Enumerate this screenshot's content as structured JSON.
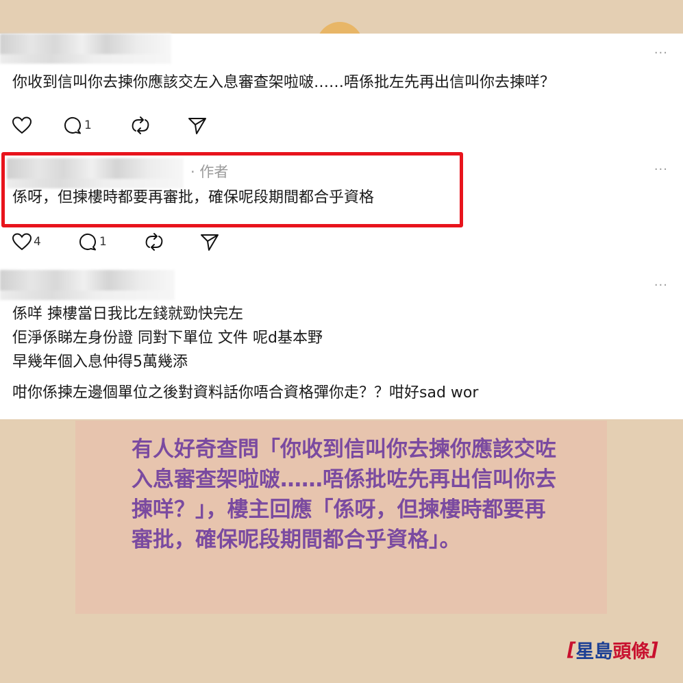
{
  "comments": [
    {
      "text": "你收到信叫你去揀你應該交左入息審查架啦啵……唔係批左先再出信叫你去揀咩？",
      "more": "···",
      "replies": "1",
      "likes": ""
    },
    {
      "author_tag": "· 作者",
      "text": "係呀，但揀樓時都要再審批，確保呢段期間都合乎資格",
      "more": "···",
      "likes": "4",
      "replies": "1"
    },
    {
      "lines": [
        "係咩 揀樓當日我比左錢就勁快完左",
        "佢淨係睇左身份證 同對下單位 文件 呢d基本野",
        "早幾年個入息仲得5萬幾添",
        "咁你係揀左邊個單位之後對資料話你唔合資格彈你走？？咁好sad wor"
      ],
      "more": "···"
    }
  ],
  "caption": "有人好奇查問「你收到信叫你去揀你應該交咗入息審查架啦啵……唔係批咗先再出信叫你去揀咩？」，樓主回應「係呀，但揀樓時都要再審批，確保呢段期間都合乎資格」。",
  "logo": {
    "left_bar": "[",
    "part1": "星島",
    "part2": "頭條",
    "right_bar": "]"
  },
  "icons": [
    "heart-icon",
    "reply-icon",
    "repost-icon",
    "share-icon",
    "more-icon"
  ],
  "colors": {
    "highlight_border": "#e8141c",
    "caption_text": "#7a4aa0",
    "logo_blue": "#1c3f94",
    "logo_red": "#c8102e"
  }
}
